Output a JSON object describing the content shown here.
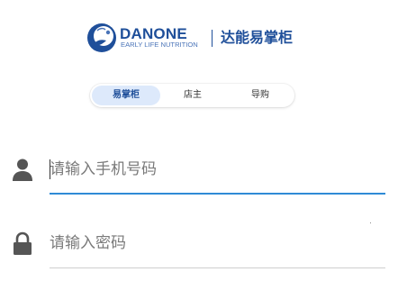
{
  "header": {
    "brand_name": "DANONE",
    "brand_subtitle": "EARLY LIFE NUTRITION",
    "app_title": "达能易掌柜",
    "brand_color": "#1f4f9a",
    "logo_icon": "danone-logo-icon"
  },
  "tabs": [
    {
      "label": "易掌柜",
      "active": true
    },
    {
      "label": "店主",
      "active": false
    },
    {
      "label": "导购",
      "active": false
    }
  ],
  "form": {
    "phone": {
      "placeholder": "请输入手机号码",
      "value": "",
      "icon": "user-icon",
      "focused": true,
      "underline_color": "#2f8bd6"
    },
    "password": {
      "placeholder": "请输入密码",
      "value": "",
      "icon": "lock-icon",
      "focused": false,
      "underline_color": "#cfcfcf"
    }
  }
}
